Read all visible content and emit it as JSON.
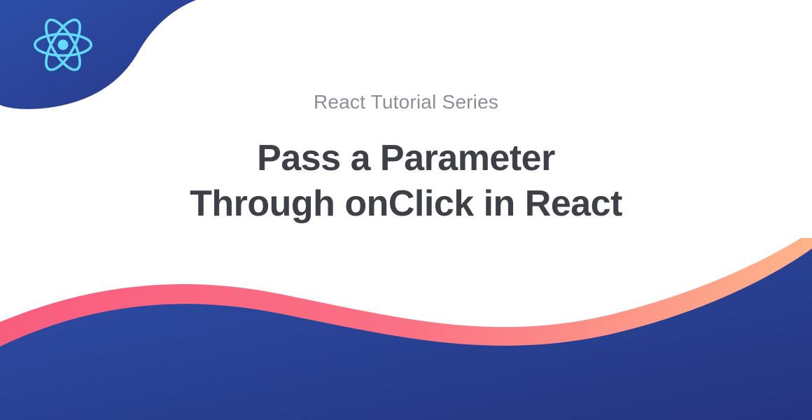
{
  "header": {
    "series_label": "React Tutorial Series",
    "title_line1": "Pass a Parameter",
    "title_line2": "Through onClick in React"
  },
  "colors": {
    "blue_dark": "#27388a",
    "blue_light": "#2d4fa8",
    "react_cyan": "#61dafb",
    "pink": "#f95d7e",
    "peach": "#ffb48a",
    "text_gray": "#8a8f99",
    "title_dark": "#3d4147"
  }
}
